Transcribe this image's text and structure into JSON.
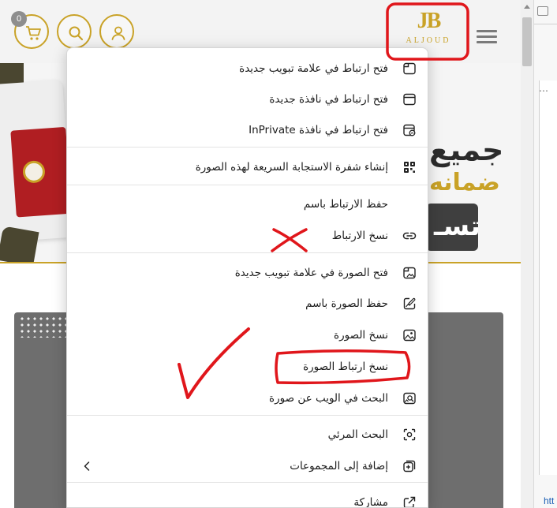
{
  "header": {
    "cart_count": "0",
    "logo_mark": "JB",
    "logo_text": "ALJOUD"
  },
  "banner": {
    "line1": "جميع",
    "line2": "ضمانه",
    "button_text": "تسـ"
  },
  "context_menu": {
    "items": [
      {
        "label": "فتح ارتباط في علامة تبويب جديدة",
        "icon": "new-tab-icon"
      },
      {
        "label": "فتح ارتباط في نافذة جديدة",
        "icon": "new-window-icon"
      },
      {
        "label": "فتح ارتباط في نافذة InPrivate",
        "icon": "inprivate-icon"
      },
      {
        "label": "إنشاء شفرة الاستجابة السريعة لهذه الصورة",
        "icon": "qr-code-icon"
      },
      {
        "label": "حفظ الارتباط باسم",
        "icon": ""
      },
      {
        "label": "نسخ الارتباط",
        "icon": "link-icon"
      },
      {
        "label": "فتح الصورة في علامة تبويب جديدة",
        "icon": "image-new-tab-icon"
      },
      {
        "label": "حفظ الصورة باسم",
        "icon": "save-image-icon"
      },
      {
        "label": "نسخ الصورة",
        "icon": "image-icon"
      },
      {
        "label": "نسخ ارتباط الصورة",
        "icon": ""
      },
      {
        "label": "البحث في الويب عن صورة",
        "icon": "image-search-icon"
      },
      {
        "label": "البحث المرئي",
        "icon": "visual-search-icon"
      },
      {
        "label": "إضافة إلى المجموعات",
        "icon": "collections-icon"
      },
      {
        "label": "مشاركة",
        "icon": "share-icon"
      }
    ]
  },
  "devtools": {
    "link_text": "htt"
  },
  "colors": {
    "gold": "#c9a227",
    "annotation_red": "#e0161b",
    "menu_bg": "#ffffff",
    "grey_card": "#6e6e6e"
  }
}
